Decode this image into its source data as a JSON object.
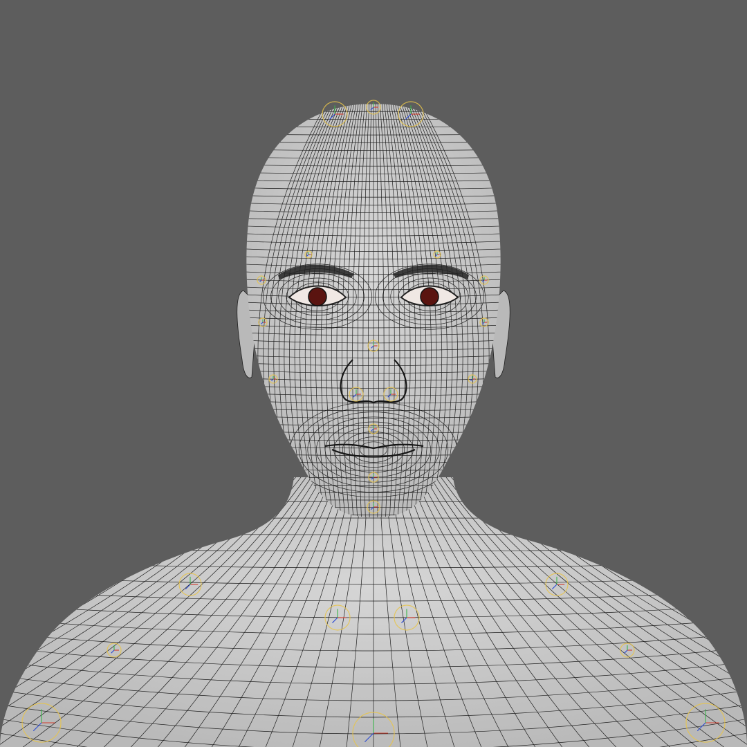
{
  "viewport": {
    "background_color": "#5d5d5d",
    "content": "wireframe-3d-head-bust-with-rig-controls"
  },
  "model": {
    "skin_color": "#d6d6d6",
    "skin_shadow_color": "#b9b9b9",
    "wire_color": "#1e1e1e",
    "eye_iris_color": "#5a1410",
    "eyebrow_color": "#222222"
  },
  "rig_controls": {
    "primary_color": "#e8c44a",
    "axis_x_color": "#d23a2a",
    "axis_y_color": "#3bb44a",
    "axis_z_color": "#2a4ad2",
    "icon": "circle-locator-icon"
  }
}
